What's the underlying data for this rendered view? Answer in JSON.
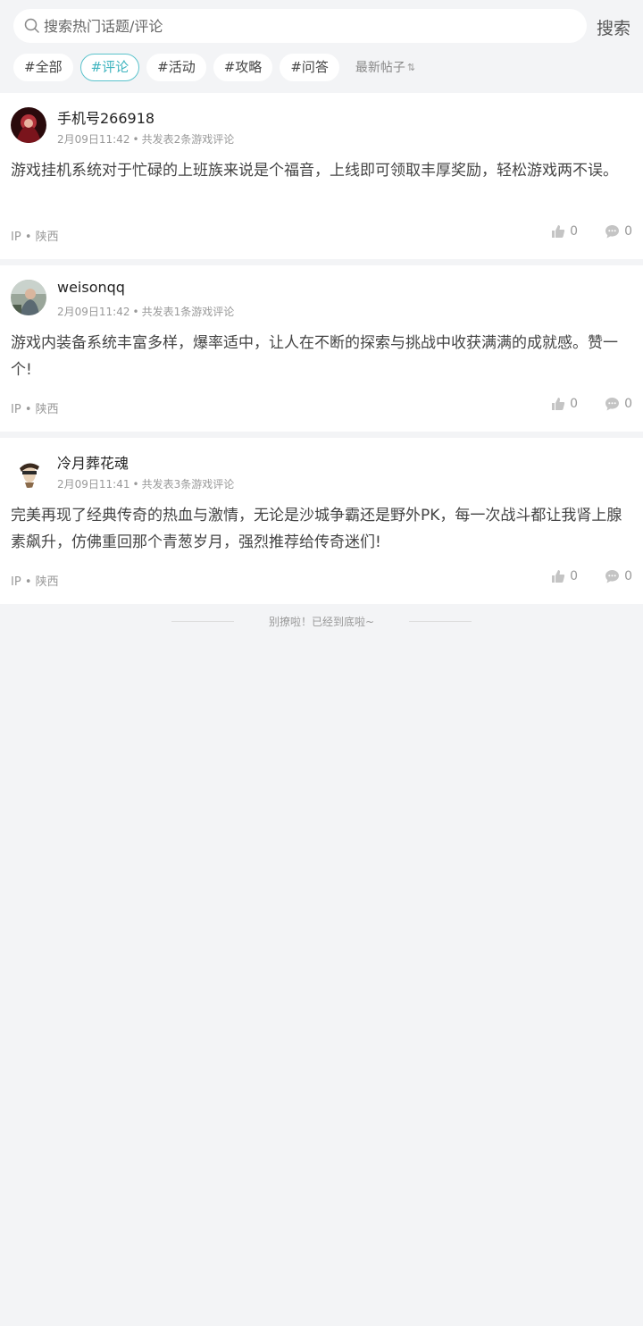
{
  "search": {
    "placeholder": "搜索热门话题/评论",
    "button_label": "搜索"
  },
  "tabs": [
    {
      "label": "#全部",
      "active": false
    },
    {
      "label": "#评论",
      "active": true
    },
    {
      "label": "#活动",
      "active": false
    },
    {
      "label": "#攻略",
      "active": false
    },
    {
      "label": "#问答",
      "active": false
    }
  ],
  "sort": {
    "label": "最新帖子",
    "icon": "sort-icon"
  },
  "posts": [
    {
      "username": "手机号266918",
      "time": "2月09日11:42",
      "summary": "共发表2条游戏评论",
      "content": "游戏挂机系统对于忙碌的上班族来说是个福音，上线即可领取丰厚奖励，轻松游戏两不误。",
      "ip_label": "IP",
      "ip_region": "陕西",
      "likes": "0",
      "comments": "0"
    },
    {
      "username": "weisonqq",
      "time": "2月09日11:42",
      "summary": "共发表1条游戏评论",
      "content": "游戏内装备系统丰富多样，爆率适中，让人在不断的探索与挑战中收获满满的成就感。赞一个!",
      "ip_label": "IP",
      "ip_region": "陕西",
      "likes": "0",
      "comments": "0"
    },
    {
      "username": "冷月葬花魂",
      "time": "2月09日11:41",
      "summary": "共发表3条游戏评论",
      "content": "完美再现了经典传奇的热血与激情，无论是沙城争霸还是野外PK，每一次战斗都让我肾上腺素飙升，仿佛重回那个青葱岁月，强烈推荐给传奇迷们!",
      "ip_label": "IP",
      "ip_region": "陕西",
      "likes": "0",
      "comments": "0"
    }
  ],
  "footer": {
    "text": "别撩啦！已经到底啦~"
  },
  "colors": {
    "accent": "#3fb4bf",
    "background": "#f3f4f6",
    "card": "#ffffff"
  }
}
